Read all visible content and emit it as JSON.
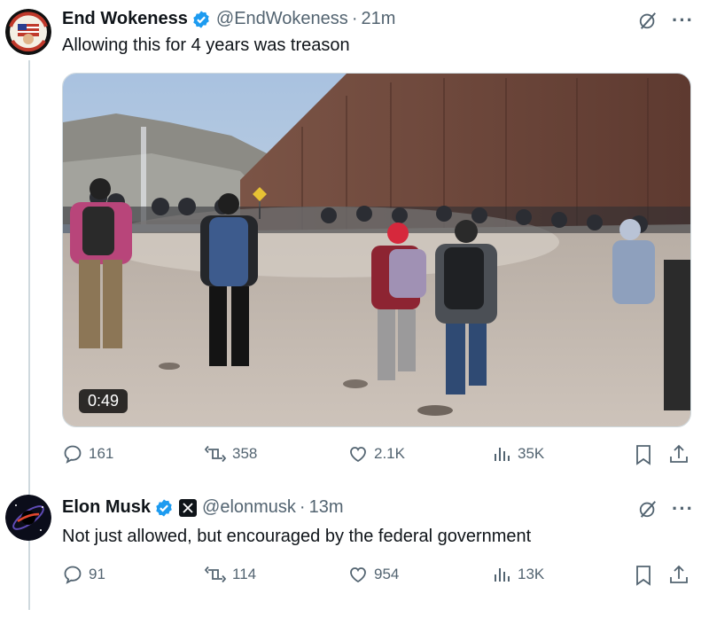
{
  "tweet1": {
    "author_name": "End Wokeness",
    "handle": "@EndWokeness",
    "separator": "·",
    "time": "21m",
    "text": "Allowing this for 4 years was treason",
    "avatar_badge_text": "I SUPPORT THE BORDER",
    "media": {
      "duration": "0:49",
      "type": "video"
    },
    "stats": {
      "replies": "161",
      "reposts": "358",
      "likes": "2.1K",
      "views": "35K"
    }
  },
  "tweet2": {
    "author_name": "Elon Musk",
    "handle": "@elonmusk",
    "separator": "·",
    "time": "13m",
    "text": "Not just allowed, but encouraged by the federal government",
    "affiliation_badge": "X",
    "stats": {
      "replies": "91",
      "reposts": "114",
      "likes": "954",
      "views": "13K"
    }
  },
  "colors": {
    "text": "#0f1419",
    "secondary": "#536471",
    "verified": "#1d9bf0",
    "thread_line": "#cfd9de"
  },
  "icons": [
    "verified-badge-icon",
    "grok-icon",
    "more-icon",
    "reply-icon",
    "repost-icon",
    "like-icon",
    "views-icon",
    "bookmark-icon",
    "share-icon"
  ]
}
